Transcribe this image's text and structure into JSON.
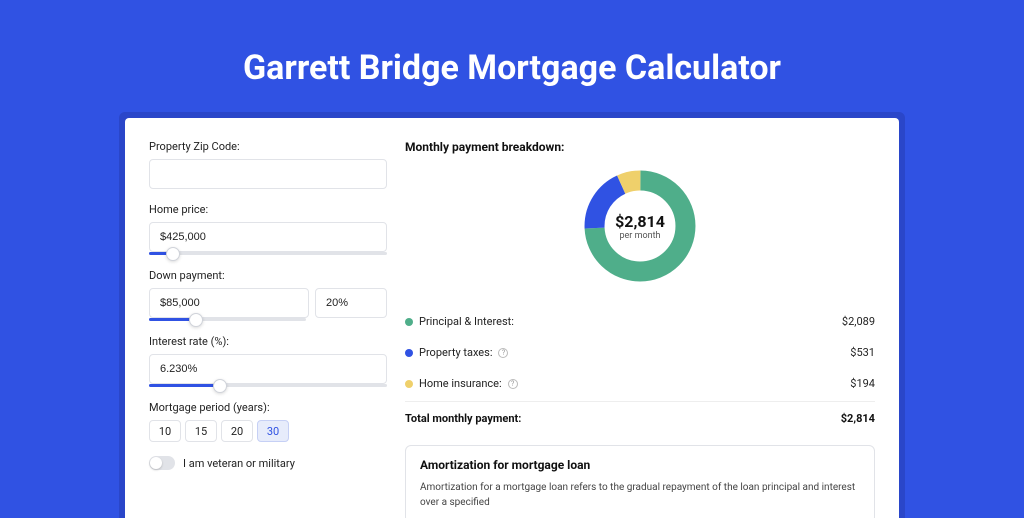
{
  "page": {
    "title": "Garrett Bridge Mortgage Calculator"
  },
  "form": {
    "zip": {
      "label": "Property Zip Code:",
      "value": ""
    },
    "home_price": {
      "label": "Home price:",
      "value": "$425,000",
      "slider_pct": 10
    },
    "down_payment": {
      "label": "Down payment:",
      "amount": "$85,000",
      "percent": "20%",
      "slider_pct": 20
    },
    "interest": {
      "label": "Interest rate (%):",
      "value": "6.230%",
      "slider_pct": 30
    },
    "period": {
      "label": "Mortgage period (years):",
      "options": [
        "10",
        "15",
        "20",
        "30"
      ],
      "selected": "30"
    },
    "veteran": {
      "label": "I am veteran or military"
    }
  },
  "breakdown": {
    "title": "Monthly payment breakdown:",
    "center_amount": "$2,814",
    "center_sub": "per month",
    "items": [
      {
        "label": "Principal & Interest:",
        "value": "$2,089",
        "color": "green",
        "info": false
      },
      {
        "label": "Property taxes:",
        "value": "$531",
        "color": "blue",
        "info": true
      },
      {
        "label": "Home insurance:",
        "value": "$194",
        "color": "yellow",
        "info": true
      }
    ],
    "total_label": "Total monthly payment:",
    "total_value": "$2,814"
  },
  "amort": {
    "title": "Amortization for mortgage loan",
    "text": "Amortization for a mortgage loan refers to the gradual repayment of the loan principal and interest over a specified"
  },
  "chart_data": {
    "type": "pie",
    "title": "Monthly payment breakdown",
    "series": [
      {
        "name": "Principal & Interest",
        "value": 2089,
        "color": "#4fae8a"
      },
      {
        "name": "Property taxes",
        "value": 531,
        "color": "#3052e3"
      },
      {
        "name": "Home insurance",
        "value": 194,
        "color": "#efd06b"
      }
    ],
    "total": 2814,
    "center_label": "$2,814 per month"
  }
}
